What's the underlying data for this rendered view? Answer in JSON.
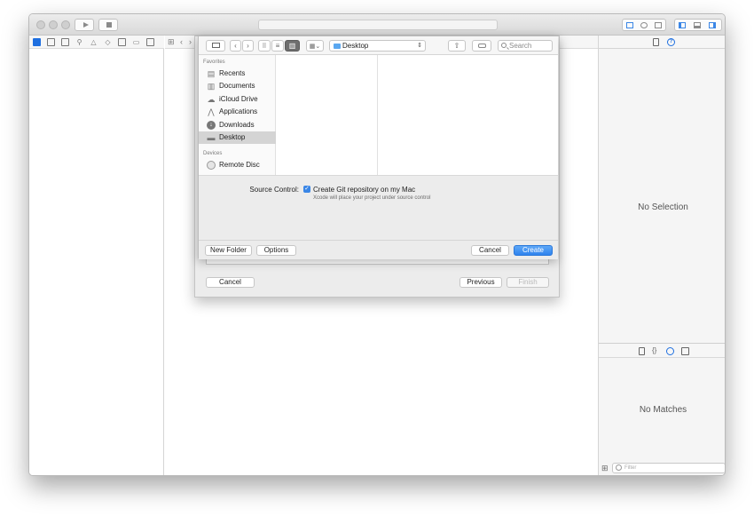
{
  "editor_tools": {
    "nav_grid": "⊞",
    "back": "‹",
    "forward": "›"
  },
  "inspector": {
    "no_selection": "No Selection",
    "library": {
      "no_matches": "No Matches",
      "filter_placeholder": "Filter"
    }
  },
  "wizard": {
    "cancel": "Cancel",
    "previous": "Previous",
    "finish": "Finish"
  },
  "save_panel": {
    "toolbar": {
      "back": "‹",
      "forward": "›",
      "location": "Desktop",
      "search_placeholder": "Search"
    },
    "sidebar": {
      "favorites_header": "Favorites",
      "favorites": [
        {
          "label": "Recents",
          "icon": "recents-icon"
        },
        {
          "label": "Documents",
          "icon": "documents-icon"
        },
        {
          "label": "iCloud Drive",
          "icon": "cloud-icon"
        },
        {
          "label": "Applications",
          "icon": "applications-icon"
        },
        {
          "label": "Downloads",
          "icon": "downloads-icon"
        },
        {
          "label": "Desktop",
          "icon": "desktop-icon",
          "selected": true
        }
      ],
      "devices_header": "Devices",
      "devices": [
        {
          "label": "Remote Disc",
          "icon": "disc-icon"
        }
      ]
    },
    "source_control": {
      "label": "Source Control:",
      "checked": true,
      "option": "Create Git repository on my Mac",
      "hint": "Xcode will place your project under source control"
    },
    "buttons": {
      "new_folder": "New Folder",
      "options": "Options",
      "cancel": "Cancel",
      "create": "Create"
    }
  },
  "colors": {
    "accent": "#3a86e6",
    "primary_button": "#2f83ee"
  }
}
